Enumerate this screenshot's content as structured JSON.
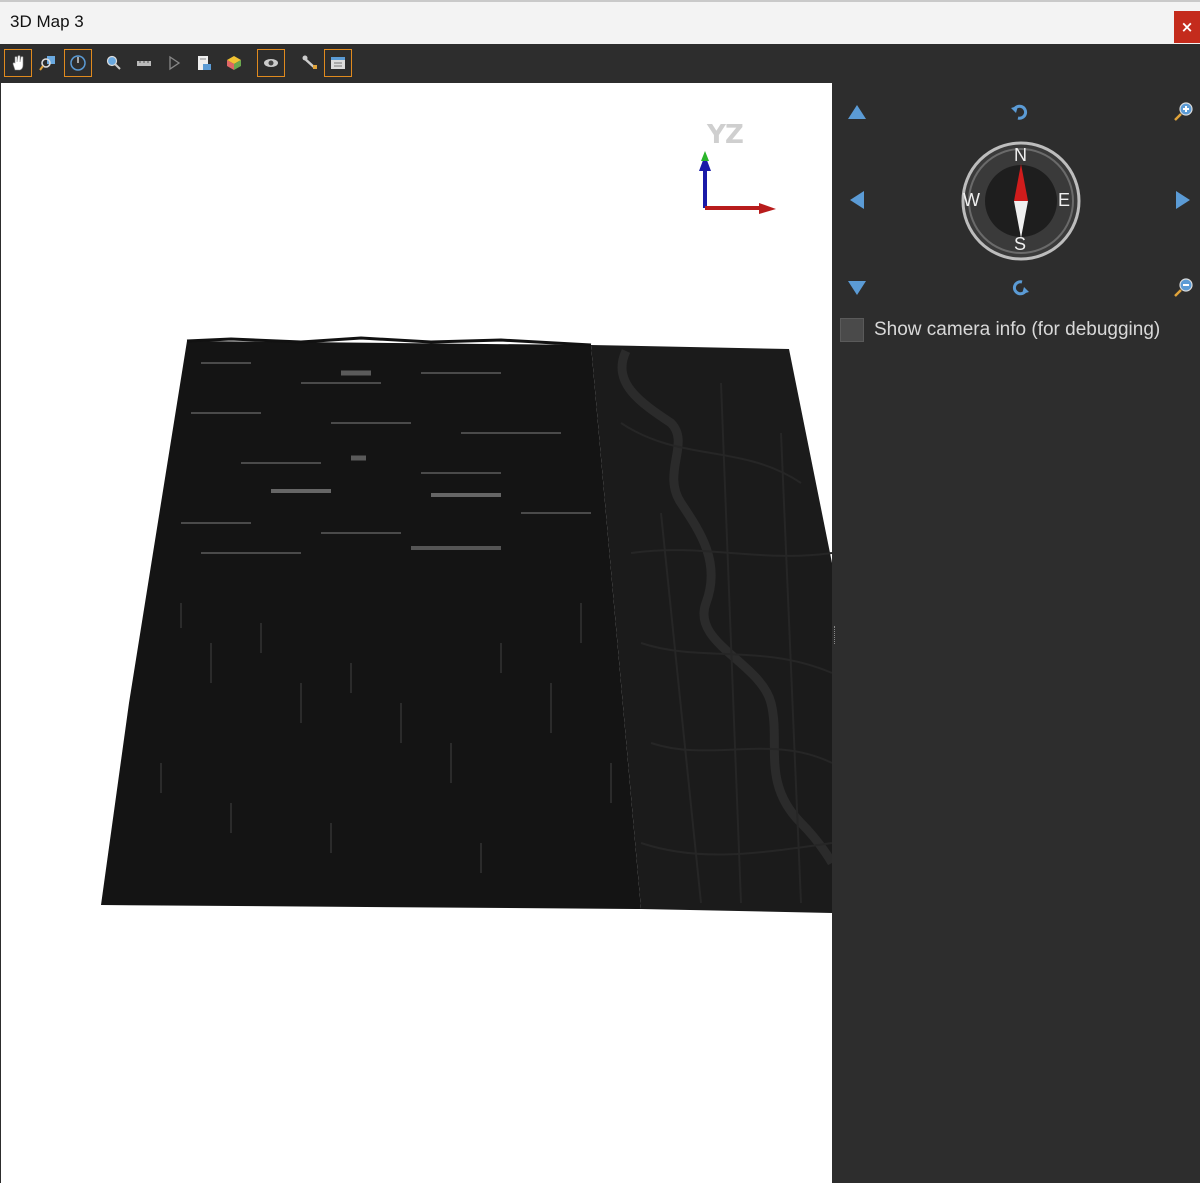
{
  "window": {
    "title": "3D Map 3",
    "close_label": "×"
  },
  "toolbar": {
    "buttons": [
      {
        "name": "pan-tool",
        "icon": "hand-icon",
        "active": true
      },
      {
        "name": "zoom-to-layer",
        "icon": "zoom-extent-icon",
        "active": false
      },
      {
        "name": "orbit-tool",
        "icon": "rotate-icon",
        "active": true
      },
      {
        "name": "identify-tool",
        "icon": "identify-icon",
        "active": false
      },
      {
        "name": "measure-tool",
        "icon": "ruler-icon",
        "active": false
      },
      {
        "name": "animation",
        "icon": "play-icon",
        "active": false
      },
      {
        "name": "save-image",
        "icon": "save-image-icon",
        "active": false
      },
      {
        "name": "export-scene",
        "icon": "cube-icon",
        "active": false
      },
      {
        "name": "camera-view",
        "icon": "eye-icon",
        "active": true
      },
      {
        "name": "effects",
        "icon": "wrench-icon",
        "active": false
      },
      {
        "name": "configure",
        "icon": "config-icon",
        "active": true
      }
    ]
  },
  "axes": {
    "y_label": "Y",
    "z_label": "Z"
  },
  "compass": {
    "north": "N",
    "south": "S",
    "east": "E",
    "west": "W"
  },
  "panel": {
    "camera_info_label": "Show camera info (for debugging)",
    "camera_info_checked": false
  },
  "colors": {
    "accent": "#e08a1e",
    "nav_blue": "#5b9bd5",
    "panel_bg": "#2d2d2d",
    "close_red": "#c42b1c",
    "terrain": "#141414",
    "map_tile": "#1b1b1b"
  }
}
